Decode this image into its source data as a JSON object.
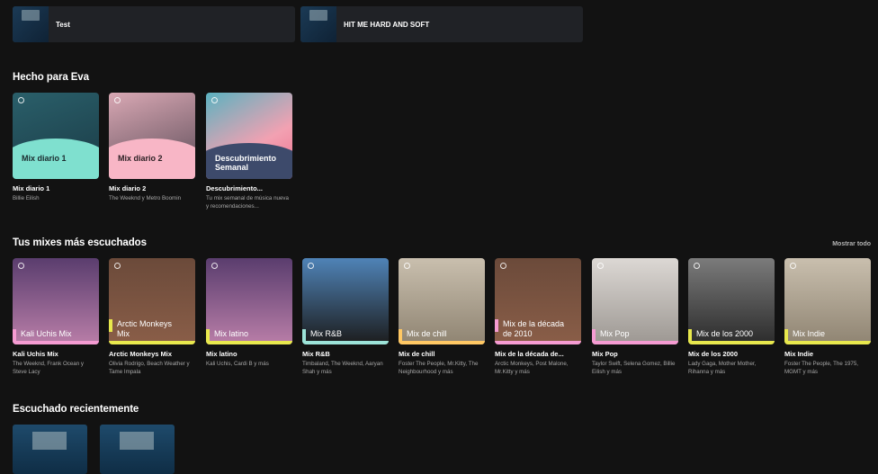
{
  "shortcuts": [
    {
      "label": "Test"
    },
    {
      "label": "HIT ME HARD AND SOFT"
    }
  ],
  "made_for": {
    "title": "Hecho para Eva",
    "cards": [
      {
        "cover_title": "Mix diario 1",
        "name": "Mix diario 1",
        "desc": "Billie Eilish"
      },
      {
        "cover_title": "Mix diario 2",
        "name": "Mix diario 2",
        "desc": "The Weeknd y Metro Boomin"
      },
      {
        "cover_title": "Descubrimiento Semanal",
        "name": "Descubrimiento...",
        "desc": "Tu mix semanal de música nueva y recomendaciones..."
      }
    ]
  },
  "top_mixes": {
    "title": "Tus mixes más escuchados",
    "show_all": "Mostrar todo",
    "cards": [
      {
        "cover_title": "Kali Uchis Mix",
        "name": "Kali Uchis Mix",
        "desc": "The Weeknd, Frank Ocean y Steve Lacy",
        "accent": "#f59bd2"
      },
      {
        "cover_title": "Arctic Monkeys Mix",
        "name": "Arctic Monkeys Mix",
        "desc": "Olivia Rodrigo, Beach Weather y Tame Impala",
        "accent": "#e8e84d"
      },
      {
        "cover_title": "Mix latino",
        "name": "Mix latino",
        "desc": "Kali Uchis, Cardi B y más",
        "accent": "#e8e84d"
      },
      {
        "cover_title": "Mix R&B",
        "name": "Mix R&B",
        "desc": "Timbaland, The Weeknd, Aaryan Shah y más",
        "accent": "#9ce3d8"
      },
      {
        "cover_title": "Mix de chill",
        "name": "Mix de chill",
        "desc": "Foster The People, Mr.Kitty, The Neighbourhood y más",
        "accent": "#ffc864"
      },
      {
        "cover_title": "Mix de la década de 2010",
        "name": "Mix de la década de...",
        "desc": "Arctic Monkeys, Post Malone, Mr.Kitty y más",
        "accent": "#f59bd2"
      },
      {
        "cover_title": "Mix Pop",
        "name": "Mix Pop",
        "desc": "Taylor Swift, Selena Gomez, Billie Eilish y más",
        "accent": "#f59bd2"
      },
      {
        "cover_title": "Mix de los 2000",
        "name": "Mix de los 2000",
        "desc": "Lady Gaga, Mother Mother, Rihanna y más",
        "accent": "#e8e84d"
      },
      {
        "cover_title": "Mix Indie",
        "name": "Mix Indie",
        "desc": "Foster The People, The 1975, MGMT y más",
        "accent": "#e8e84d"
      }
    ]
  },
  "recent": {
    "title": "Escuchado recientemente"
  }
}
